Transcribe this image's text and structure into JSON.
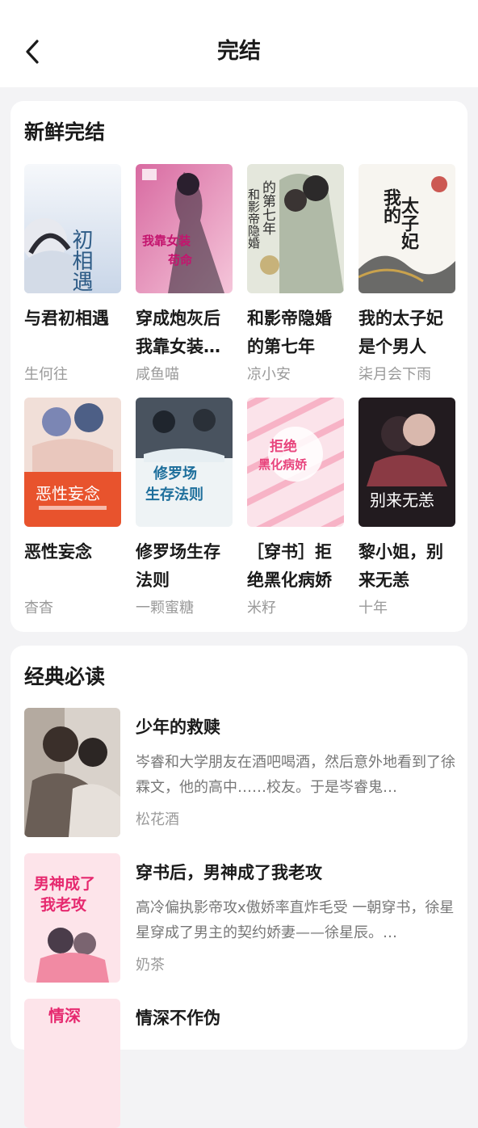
{
  "header": {
    "title": "完结",
    "back_icon": "chevron-left-icon"
  },
  "fresh": {
    "title": "新鲜完结",
    "books": [
      {
        "title": "与君初相遇",
        "author": "生何往",
        "cover_text": "初相遇",
        "cover_colors": [
          "#eef1f6",
          "#c9d6e8"
        ]
      },
      {
        "title": "穿成炮灰后我靠女装…",
        "author": "咸鱼喵",
        "cover_text": "我靠女装苟命",
        "cover_colors": [
          "#c64e85",
          "#f2b7d0"
        ]
      },
      {
        "title": "和影帝隐婚的第七年",
        "author": "凉小安",
        "cover_text": "和影帝隐婚的第七年",
        "cover_colors": [
          "#d8dccd",
          "#8c9a85"
        ]
      },
      {
        "title": "我的太子妃是个男人",
        "author": "柒月会下雨",
        "cover_text": "我的太子妃",
        "cover_colors": [
          "#f5f3ee",
          "#cfc7b8"
        ]
      },
      {
        "title": "恶性妄念",
        "author": "杳杳",
        "cover_text": "恶性妄念",
        "cover_colors": [
          "#f3e3dc",
          "#e8532d"
        ]
      },
      {
        "title": "修罗场生存法则",
        "author": "一颗蜜糖",
        "cover_text": "修罗场生存法则",
        "cover_colors": [
          "#4c5665",
          "#e6eef2"
        ]
      },
      {
        "title": "［穿书］拒绝黑化病娇",
        "author": "米籽",
        "cover_text": "拒绝黑化病娇",
        "cover_colors": [
          "#fbe3ea",
          "#f59bb5"
        ]
      },
      {
        "title": "黎小姐，别来无恙",
        "author": "十年",
        "cover_text": "别来无恙",
        "cover_colors": [
          "#2a2024",
          "#8a3a44"
        ]
      }
    ]
  },
  "classic": {
    "title": "经典必读",
    "items": [
      {
        "title": "少年的救赎",
        "desc": "岑睿和大学朋友在酒吧喝酒，然后意外地看到了徐霖文，他的高中……校友。于是岑睿鬼…",
        "author": "松花酒",
        "cover_colors": [
          "#7b6e63",
          "#d9d2cb"
        ]
      },
      {
        "title": "穿书后，男神成了我老攻",
        "desc": "高冷偏执影帝攻x傲娇率直炸毛受 一朝穿书，徐星星穿成了男主的契约娇妻——徐星辰。…",
        "author": "奶茶",
        "cover_text": "男神成了我老攻",
        "cover_colors": [
          "#fde4ea",
          "#f18aa3"
        ]
      },
      {
        "title": "情深不作伪",
        "cover_text": "情深",
        "cover_colors": [
          "#fde4ea",
          "#f5a3b8"
        ]
      }
    ]
  }
}
